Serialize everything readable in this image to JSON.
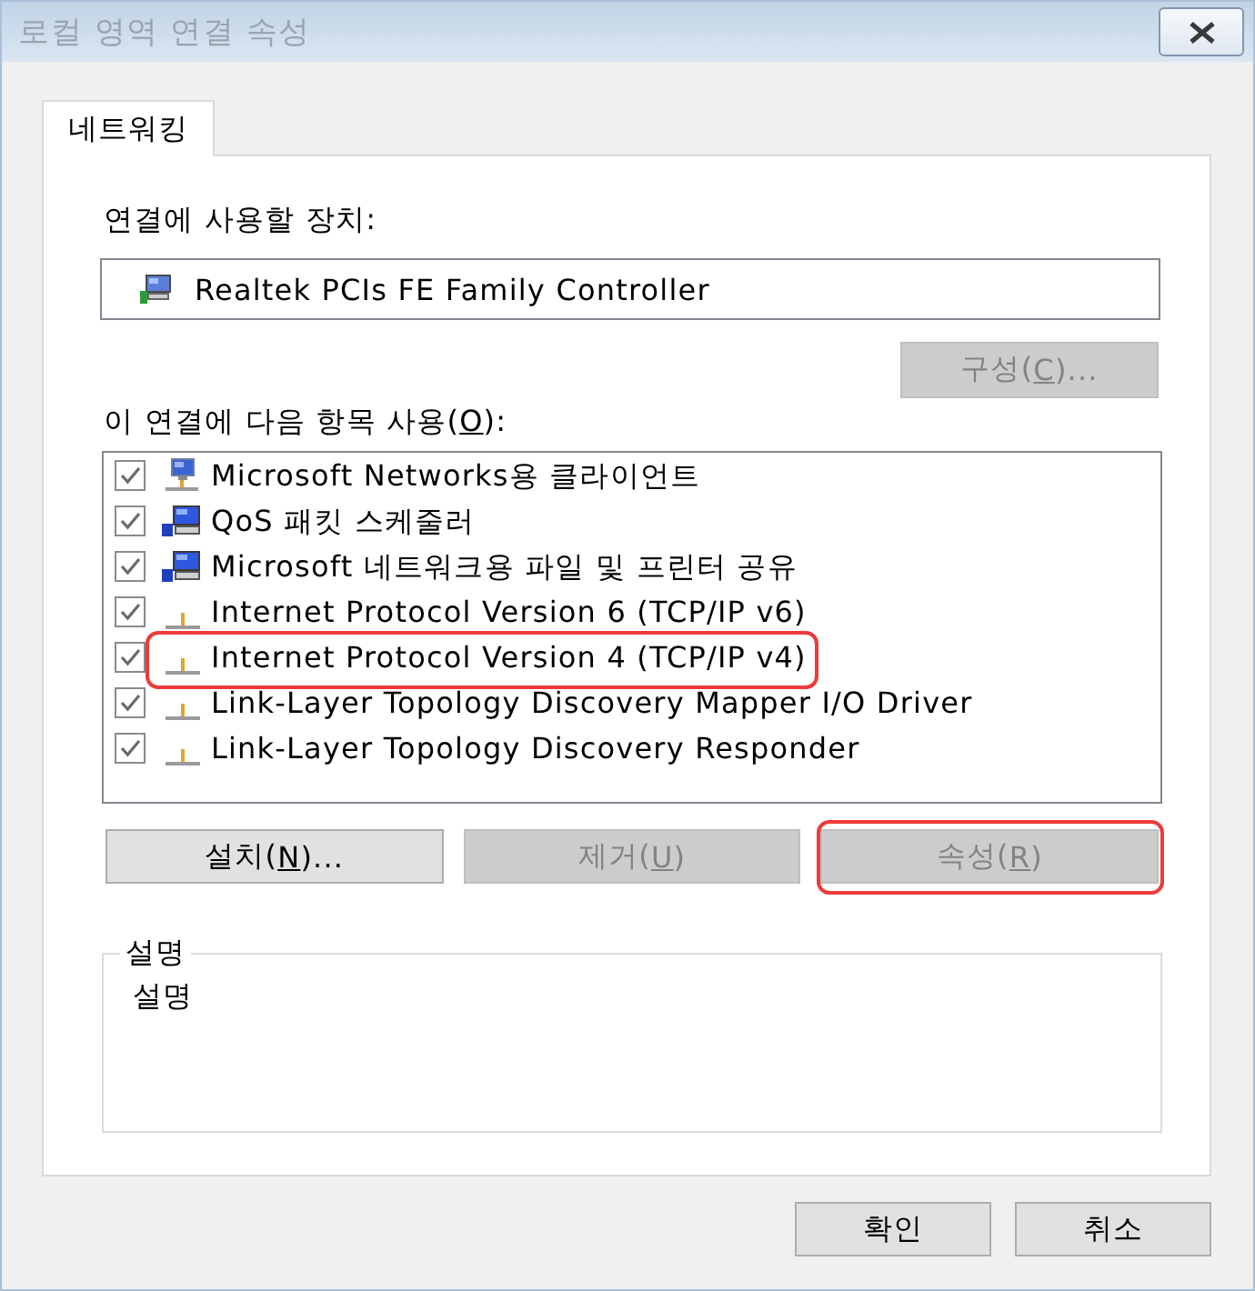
{
  "window": {
    "title": "로컬 영역 연결 속성"
  },
  "tabs": [
    {
      "label": "네트워킹",
      "selected": true
    }
  ],
  "device": {
    "label": "연결에 사용할 장치:",
    "value": "Realtek PCIs FE Family Controller",
    "configure_button": {
      "label": "구성(C)...",
      "access_key_underlined": true,
      "disabled": true
    }
  },
  "components": {
    "label": "이 연결에 다음 항목 사용(O):",
    "access_key_underlined": true,
    "items": [
      {
        "kind": "client",
        "label": "Microsoft Networks용 클라이언트",
        "checked": true,
        "selected": false,
        "annotated": false
      },
      {
        "kind": "service",
        "label": "QoS 패킷 스케줄러",
        "checked": true,
        "selected": false,
        "annotated": false
      },
      {
        "kind": "service",
        "label": "Microsoft 네트워크용 파일 및 프린터 공유",
        "checked": true,
        "selected": false,
        "annotated": false
      },
      {
        "kind": "protocol",
        "label": "Internet Protocol Version 6 (TCP/IP v6)",
        "checked": true,
        "selected": false,
        "annotated": false
      },
      {
        "kind": "protocol",
        "label": "Internet Protocol Version 4 (TCP/IP v4)",
        "checked": true,
        "selected": false,
        "annotated": true
      },
      {
        "kind": "protocol",
        "label": "Link-Layer Topology Discovery Mapper I/O Driver",
        "checked": true,
        "selected": false,
        "annotated": false
      },
      {
        "kind": "protocol",
        "label": "Link-Layer Topology Discovery Responder",
        "checked": true,
        "selected": false,
        "annotated": false
      }
    ]
  },
  "component_buttons": [
    {
      "label": "설치(N)...",
      "access_key_underlined": true,
      "disabled": false,
      "annotated": false
    },
    {
      "label": "제거(U)",
      "access_key_underlined": true,
      "disabled": true,
      "annotated": false
    },
    {
      "label": "속성(R)",
      "access_key_underlined": true,
      "disabled": true,
      "annotated": true
    }
  ],
  "description": {
    "title": "설명",
    "text": "설명"
  },
  "dialog_buttons": [
    {
      "label": "확인"
    },
    {
      "label": "취소"
    }
  ]
}
